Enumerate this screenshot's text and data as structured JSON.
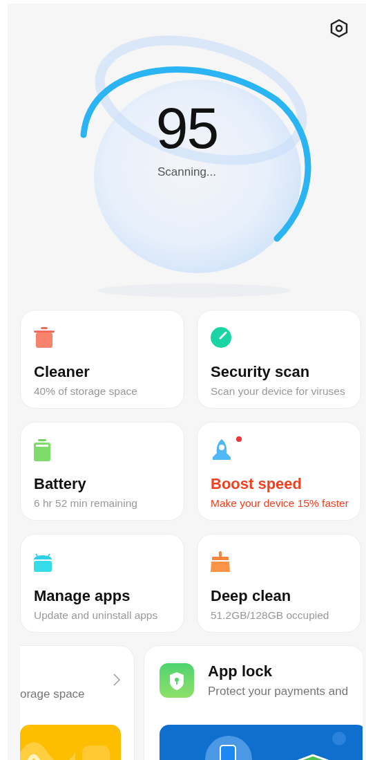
{
  "score": {
    "value": "95",
    "status": "Scanning..."
  },
  "tools": [
    {
      "kind": "trash",
      "title": "Cleaner",
      "subtitle": "40% of storage space",
      "alert": false
    },
    {
      "kind": "gauge",
      "title": "Security scan",
      "subtitle": "Scan your device for viruses",
      "alert": false
    },
    {
      "kind": "battery",
      "title": "Battery",
      "subtitle": "6 hr 52 min  remaining",
      "alert": false
    },
    {
      "kind": "rocket",
      "title": "Boost speed",
      "subtitle": "Make your device 15% faster",
      "alert": true
    },
    {
      "kind": "android",
      "title": "Manage apps",
      "subtitle": "Update and uninstall apps",
      "alert": false
    },
    {
      "kind": "brush",
      "title": "Deep clean",
      "subtitle": "51.2GB/128GB occupied",
      "alert": false
    }
  ],
  "features": [
    {
      "kind": "partial",
      "subtitle": "orage space"
    },
    {
      "kind": "full",
      "title": "App lock",
      "subtitle": "Protect your payments and"
    }
  ]
}
